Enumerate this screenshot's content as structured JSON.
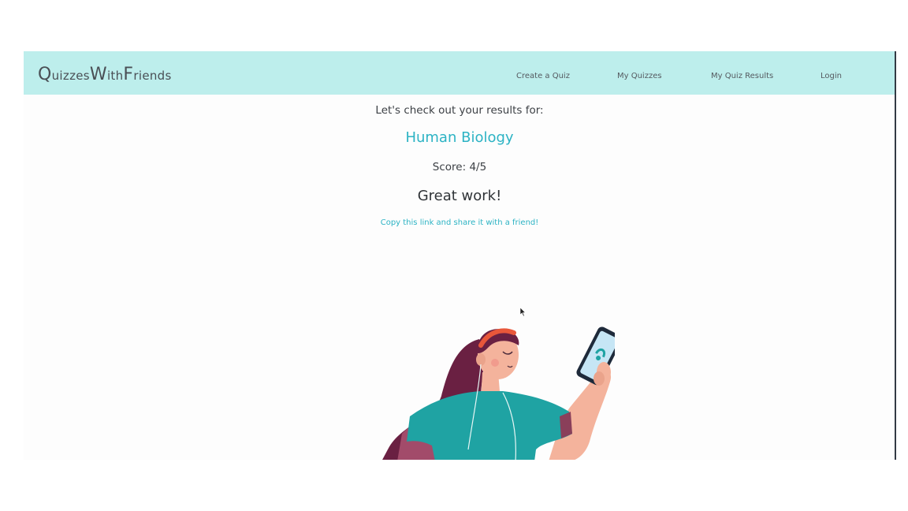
{
  "navbar": {
    "brand": [
      "Q",
      "uizzes",
      "W",
      "ith",
      "F",
      "riends"
    ],
    "links": [
      "Create a Quiz",
      "My Quizzes",
      "My Quiz Results",
      "Login"
    ]
  },
  "results": {
    "intro": "Let's check out your results for:",
    "quiz_title": "Human Biology",
    "score": "Score: 4/5",
    "praise": "Great work!",
    "share_link": "Copy this link and share it with a friend!"
  },
  "colors": {
    "navbar_bg": "#bdeeec",
    "accent": "#2cb3c4",
    "text": "#3b3f44"
  }
}
